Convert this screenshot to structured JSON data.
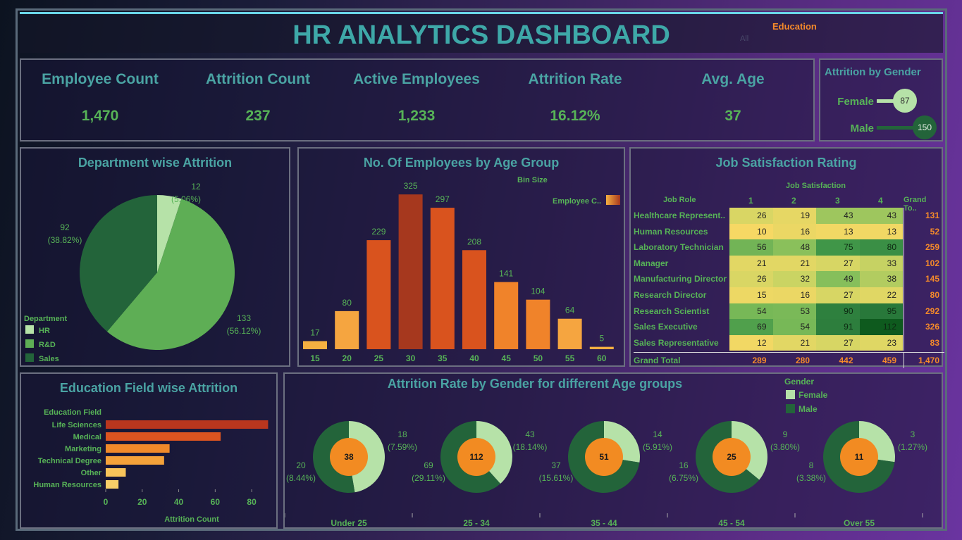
{
  "header": {
    "title": "HR ANALYTICS DASHBOARD",
    "education_filter": "Education",
    "filter_value": "All"
  },
  "kpis": [
    {
      "label": "Employee Count",
      "value": "1,470"
    },
    {
      "label": "Attrition Count",
      "value": "237"
    },
    {
      "label": "Active Employees",
      "value": "1,233"
    },
    {
      "label": "Attrition Rate",
      "value": "16.12%"
    },
    {
      "label": "Avg. Age",
      "value": "37"
    }
  ],
  "gender": {
    "title": "Attrition by Gender",
    "rows": [
      {
        "label": "Female",
        "value": "87",
        "color": "#b6e2a8"
      },
      {
        "label": "Male",
        "value": "150",
        "color": "#23643a"
      }
    ]
  },
  "colors": {
    "hr": "#b6e2a8",
    "rnd": "#5eae55",
    "sales": "#23643a",
    "female": "#b6e2a8",
    "male": "#23643a",
    "donut_center": "#f28b22",
    "accent": "#4aa3a3",
    "value_green": "#57b357"
  },
  "chart_data": [
    {
      "type": "pie",
      "title": "Department wise Attrition",
      "legend_title": "Department",
      "categories": [
        "HR",
        "R&D",
        "Sales"
      ],
      "values": [
        12,
        133,
        92
      ],
      "labels": [
        {
          "v": "12",
          "p": "(5.06%)"
        },
        {
          "v": "133",
          "p": "(56.12%)"
        },
        {
          "v": "92",
          "p": "(38.82%)"
        }
      ]
    },
    {
      "type": "bar",
      "title": "No. Of Employees by Age Group",
      "legend_title": "Employee C..",
      "bin_label": "Bin Size",
      "categories": [
        "15",
        "20",
        "25",
        "30",
        "35",
        "40",
        "45",
        "50",
        "55",
        "60"
      ],
      "values": [
        17,
        80,
        229,
        325,
        297,
        208,
        141,
        104,
        64,
        5
      ],
      "ylim": [
        0,
        340
      ]
    },
    {
      "type": "table",
      "title": "Job Satisfaction Rating",
      "column_group": "Job Satisfaction",
      "row_header": "Job Role",
      "columns": [
        "1",
        "2",
        "3",
        "4",
        "Grand To.."
      ],
      "rows": [
        {
          "role": "Healthcare Represent..",
          "values": [
            26,
            19,
            43,
            43
          ],
          "total": "131"
        },
        {
          "role": "Human Resources",
          "values": [
            10,
            16,
            13,
            13
          ],
          "total": "52"
        },
        {
          "role": "Laboratory Technician",
          "values": [
            56,
            48,
            75,
            80
          ],
          "total": "259"
        },
        {
          "role": "Manager",
          "values": [
            21,
            21,
            27,
            33
          ],
          "total": "102"
        },
        {
          "role": "Manufacturing Director",
          "values": [
            26,
            32,
            49,
            38
          ],
          "total": "145"
        },
        {
          "role": "Research Director",
          "values": [
            15,
            16,
            27,
            22
          ],
          "total": "80"
        },
        {
          "role": "Research Scientist",
          "values": [
            54,
            53,
            90,
            95
          ],
          "total": "292"
        },
        {
          "role": "Sales Executive",
          "values": [
            69,
            54,
            91,
            112
          ],
          "total": "326"
        },
        {
          "role": "Sales Representative",
          "values": [
            12,
            21,
            27,
            23
          ],
          "total": "83"
        }
      ],
      "grand_total": {
        "label": "Grand Total",
        "values": [
          "289",
          "280",
          "442",
          "459"
        ],
        "total": "1,470"
      }
    },
    {
      "type": "bar",
      "title": "Education Field wise Attrition",
      "orientation": "horizontal",
      "ylabel": "Education Field",
      "xlabel": "Attrition Count",
      "categories": [
        "Life Sciences",
        "Medical",
        "Marketing",
        "Technical Degree",
        "Other",
        "Human Resources"
      ],
      "values": [
        89,
        63,
        35,
        32,
        11,
        7
      ],
      "xlim": [
        0,
        90
      ],
      "xticks": [
        "0",
        "20",
        "40",
        "60",
        "80"
      ]
    },
    {
      "type": "pie",
      "title": "Attrition Rate by Gender for different Age groups",
      "legend_title": "Gender",
      "legend": [
        "Female",
        "Male"
      ],
      "groups": [
        {
          "name": "Under 25",
          "total": "38",
          "female": 18,
          "male": 20,
          "female_label": {
            "v": "18",
            "p": "(7.59%)"
          },
          "male_label": {
            "v": "20",
            "p": "(8.44%)"
          }
        },
        {
          "name": "25 - 34",
          "total": "112",
          "female": 43,
          "male": 69,
          "female_label": {
            "v": "43",
            "p": "(18.14%)"
          },
          "male_label": {
            "v": "69",
            "p": "(29.11%)"
          }
        },
        {
          "name": "35 - 44",
          "total": "51",
          "female": 14,
          "male": 37,
          "female_label": {
            "v": "14",
            "p": "(5.91%)"
          },
          "male_label": {
            "v": "37",
            "p": "(15.61%)"
          }
        },
        {
          "name": "45 - 54",
          "total": "25",
          "female": 9,
          "male": 16,
          "female_label": {
            "v": "9",
            "p": "(3.80%)"
          },
          "male_label": {
            "v": "16",
            "p": "(6.75%)"
          }
        },
        {
          "name": "Over 55",
          "total": "11",
          "female": 3,
          "male": 8,
          "female_label": {
            "v": "3",
            "p": "(1.27%)"
          },
          "male_label": {
            "v": "8",
            "p": "(3.38%)"
          }
        }
      ]
    }
  ]
}
